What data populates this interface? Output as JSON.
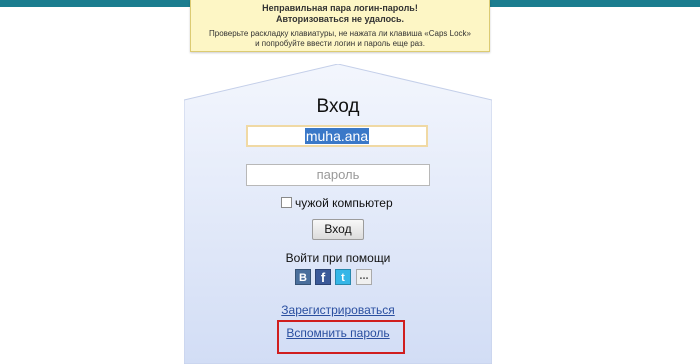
{
  "colors": {
    "top_bar": "#1b7d8f",
    "error_background": "#fdf6c5",
    "panel_top": "#f3f6fd",
    "panel_bottom": "#d2ddf5",
    "link": "#2a4fa0",
    "highlight": "#d01e1e"
  },
  "error": {
    "title": "Неправильная пара логин-пароль!",
    "subtitle": "Авторизоваться не удалось.",
    "hint_line1": "Проверьте раскладку клавиатуры, не нажата ли клавиша «Caps Lock»",
    "hint_line2": "и попробуйте ввести логин и пароль еще раз."
  },
  "login_form": {
    "title": "Вход",
    "login_value": "muha.ana",
    "password_placeholder": "пароль",
    "foreign_computer_label": "чужой компьютер",
    "foreign_computer_checked": false,
    "submit_label": "Вход"
  },
  "social": {
    "label": "Войти при помощи",
    "buttons": [
      {
        "name": "vkontakte",
        "icon": "vk-icon",
        "glyph": "В"
      },
      {
        "name": "facebook",
        "icon": "facebook-icon",
        "glyph": "f"
      },
      {
        "name": "twitter",
        "icon": "twitter-icon",
        "glyph": "t"
      },
      {
        "name": "more",
        "icon": "more-icon",
        "glyph": "..."
      }
    ]
  },
  "links": {
    "register": "Зарегистрироваться",
    "remind_password": "Вспомнить пароль"
  }
}
